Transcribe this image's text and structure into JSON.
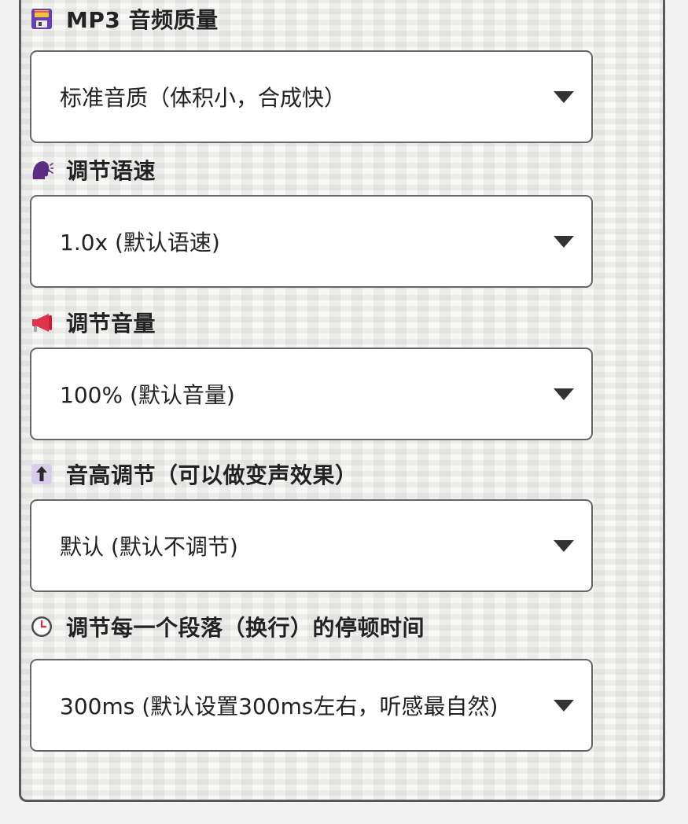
{
  "settings": [
    {
      "icon": "floppy-disk-icon",
      "label": "MP3 音频质量",
      "value": "标准音质（体积小，合成快）"
    },
    {
      "icon": "speaking-head-icon",
      "label": "调节语速",
      "value": "1.0x (默认语速)"
    },
    {
      "icon": "megaphone-icon",
      "label": "调节音量",
      "value": "100% (默认音量)"
    },
    {
      "icon": "up-arrow-icon",
      "label": "音高调节（可以做变声效果）",
      "value": "默认 (默认不调节)"
    },
    {
      "icon": "clock-icon",
      "label": "调节每一个段落（换行）的停顿时间",
      "value": "300ms (默认设置300ms左右，听感最自然)"
    }
  ]
}
